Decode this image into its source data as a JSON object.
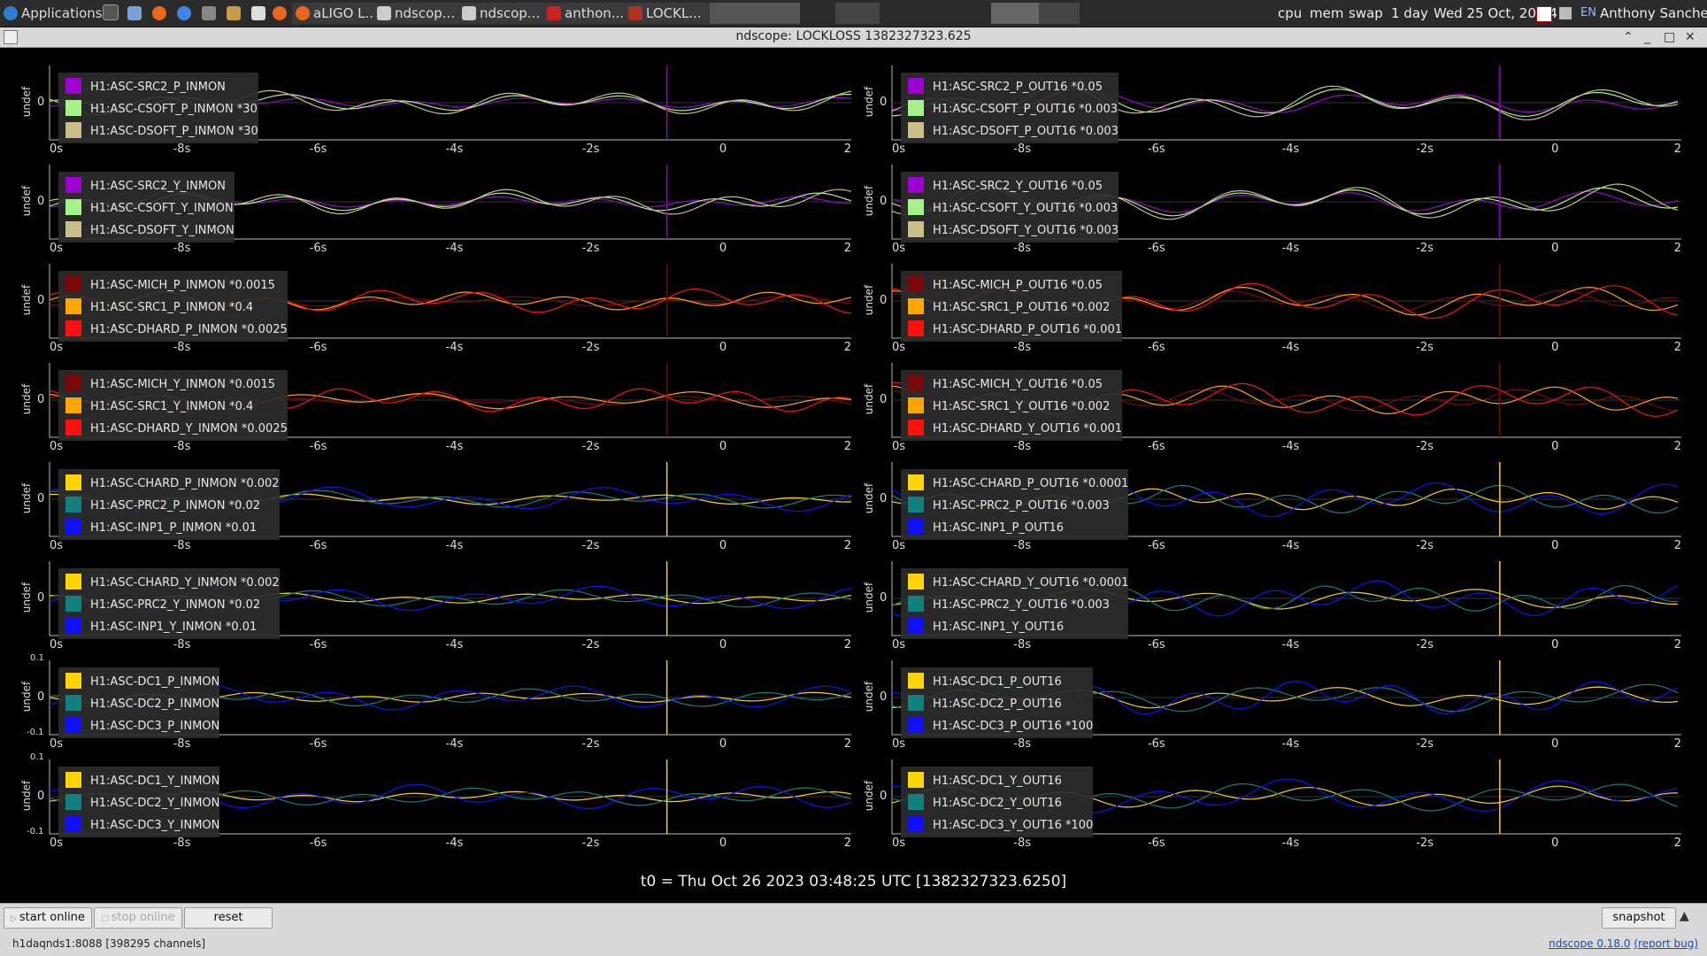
{
  "taskbar": {
    "apps_label": "Applications",
    "windows": [
      {
        "label": "aLIGO L...",
        "icon": "firefox-icon"
      },
      {
        "label": "ndscop...",
        "icon": "window-icon"
      },
      {
        "label": "ndscop...",
        "icon": "window-icon"
      },
      {
        "label": "anthon...",
        "icon": "terminal-icon"
      },
      {
        "label": "LOCKL...",
        "icon": "x-icon"
      }
    ],
    "cpu": "cpu",
    "mem": "mem",
    "swap": "swap",
    "uptime": "1 day",
    "clock": "Wed 25 Oct, 20:54",
    "lang": "EN",
    "user": "Anthony Sanchez"
  },
  "window": {
    "title": "ndscope: LOCKLOSS 1382327323.625"
  },
  "xaxis_ticks": [
    "0s",
    "-8s",
    "-6s",
    "-4s",
    "-2s",
    "0",
    "2"
  ],
  "colors": {
    "purple": "#9b00d0",
    "lightgreen": "#a6f28a",
    "khaki": "#c8c088",
    "darkred": "#7a0a0a",
    "orange": "#ffa500",
    "red": "#ff1010",
    "yellow": "#ffd400",
    "teal": "#118080",
    "blue": "#1010ff"
  },
  "panels": [
    {
      "ylabel": "undef",
      "zero": "0",
      "legend": [
        {
          "name": "H1:ASC-SRC2_P_INMON",
          "color": "#9b00d0"
        },
        {
          "name": "H1:ASC-CSOFT_P_INMON *30",
          "color": "#a6f28a"
        },
        {
          "name": "H1:ASC-DSOFT_P_INMON *30",
          "color": "#c8c088"
        }
      ]
    },
    {
      "ylabel": "undef",
      "zero": "0",
      "legend": [
        {
          "name": "H1:ASC-SRC2_P_OUT16 *0.05",
          "color": "#9b00d0"
        },
        {
          "name": "H1:ASC-CSOFT_P_OUT16 *0.003",
          "color": "#a6f28a"
        },
        {
          "name": "H1:ASC-DSOFT_P_OUT16 *0.003",
          "color": "#c8c088"
        }
      ]
    },
    {
      "ylabel": "undef",
      "zero": "0",
      "legend": [
        {
          "name": "H1:ASC-SRC2_Y_INMON",
          "color": "#9b00d0"
        },
        {
          "name": "H1:ASC-CSOFT_Y_INMON",
          "color": "#a6f28a"
        },
        {
          "name": "H1:ASC-DSOFT_Y_INMON",
          "color": "#c8c088"
        }
      ]
    },
    {
      "ylabel": "undef",
      "zero": "0",
      "legend": [
        {
          "name": "H1:ASC-SRC2_Y_OUT16 *0.05",
          "color": "#9b00d0"
        },
        {
          "name": "H1:ASC-CSOFT_Y_OUT16 *0.003",
          "color": "#a6f28a"
        },
        {
          "name": "H1:ASC-DSOFT_Y_OUT16 *0.003",
          "color": "#c8c088"
        }
      ]
    },
    {
      "ylabel": "undef",
      "zero": "0",
      "legend": [
        {
          "name": "H1:ASC-MICH_P_INMON *0.0015",
          "color": "#7a0a0a"
        },
        {
          "name": "H1:ASC-SRC1_P_INMON *0.4",
          "color": "#ffa500"
        },
        {
          "name": "H1:ASC-DHARD_P_INMON *0.0025",
          "color": "#ff1010"
        }
      ]
    },
    {
      "ylabel": "undef",
      "zero": "0",
      "legend": [
        {
          "name": "H1:ASC-MICH_P_OUT16 *0.05",
          "color": "#7a0a0a"
        },
        {
          "name": "H1:ASC-SRC1_P_OUT16 *0.002",
          "color": "#ffa500"
        },
        {
          "name": "H1:ASC-DHARD_P_OUT16 *0.001",
          "color": "#ff1010"
        }
      ]
    },
    {
      "ylabel": "undef",
      "zero": "0",
      "legend": [
        {
          "name": "H1:ASC-MICH_Y_INMON *0.0015",
          "color": "#7a0a0a"
        },
        {
          "name": "H1:ASC-SRC1_Y_INMON *0.4",
          "color": "#ffa500"
        },
        {
          "name": "H1:ASC-DHARD_Y_INMON *0.0025",
          "color": "#ff1010"
        }
      ]
    },
    {
      "ylabel": "undef",
      "zero": "0",
      "legend": [
        {
          "name": "H1:ASC-MICH_Y_OUT16 *0.05",
          "color": "#7a0a0a"
        },
        {
          "name": "H1:ASC-SRC1_Y_OUT16 *0.002",
          "color": "#ffa500"
        },
        {
          "name": "H1:ASC-DHARD_Y_OUT16 *0.001",
          "color": "#ff1010"
        }
      ]
    },
    {
      "ylabel": "undef",
      "zero": "0",
      "legend": [
        {
          "name": "H1:ASC-CHARD_P_INMON *0.002",
          "color": "#ffd400"
        },
        {
          "name": "H1:ASC-PRC2_P_INMON *0.02",
          "color": "#118080"
        },
        {
          "name": "H1:ASC-INP1_P_INMON *0.01",
          "color": "#1010ff"
        }
      ]
    },
    {
      "ylabel": "undef",
      "zero": "0",
      "legend": [
        {
          "name": "H1:ASC-CHARD_P_OUT16 *0.0001",
          "color": "#ffd400"
        },
        {
          "name": "H1:ASC-PRC2_P_OUT16 *0.003",
          "color": "#118080"
        },
        {
          "name": "H1:ASC-INP1_P_OUT16",
          "color": "#1010ff"
        }
      ]
    },
    {
      "ylabel": "undef",
      "zero": "0",
      "legend": [
        {
          "name": "H1:ASC-CHARD_Y_INMON *0.002",
          "color": "#ffd400"
        },
        {
          "name": "H1:ASC-PRC2_Y_INMON *0.02",
          "color": "#118080"
        },
        {
          "name": "H1:ASC-INP1_Y_INMON *0.01",
          "color": "#1010ff"
        }
      ]
    },
    {
      "ylabel": "undef",
      "zero": "0",
      "legend": [
        {
          "name": "H1:ASC-CHARD_Y_OUT16 *0.0001",
          "color": "#ffd400"
        },
        {
          "name": "H1:ASC-PRC2_Y_OUT16 *0.003",
          "color": "#118080"
        },
        {
          "name": "H1:ASC-INP1_Y_OUT16",
          "color": "#1010ff"
        }
      ]
    },
    {
      "ylabel": "undef",
      "zero": "0",
      "top_tick": "0.1",
      "bottom_tick": "-0.1",
      "legend": [
        {
          "name": "H1:ASC-DC1_P_INMON",
          "color": "#ffd400"
        },
        {
          "name": "H1:ASC-DC2_P_INMON",
          "color": "#118080"
        },
        {
          "name": "H1:ASC-DC3_P_INMON",
          "color": "#1010ff"
        }
      ]
    },
    {
      "ylabel": "undef",
      "zero": "0",
      "legend": [
        {
          "name": "H1:ASC-DC1_P_OUT16",
          "color": "#ffd400"
        },
        {
          "name": "H1:ASC-DC2_P_OUT16",
          "color": "#118080"
        },
        {
          "name": "H1:ASC-DC3_P_OUT16 *100",
          "color": "#1010ff"
        }
      ]
    },
    {
      "ylabel": "undef",
      "zero": "0",
      "top_tick": "0.1",
      "bottom_tick": "-0.1",
      "legend": [
        {
          "name": "H1:ASC-DC1_Y_INMON",
          "color": "#ffd400"
        },
        {
          "name": "H1:ASC-DC2_Y_INMON",
          "color": "#118080"
        },
        {
          "name": "H1:ASC-DC3_Y_INMON",
          "color": "#1010ff"
        }
      ]
    },
    {
      "ylabel": "undef",
      "zero": "0",
      "legend": [
        {
          "name": "H1:ASC-DC1_Y_OUT16",
          "color": "#ffd400"
        },
        {
          "name": "H1:ASC-DC2_Y_OUT16",
          "color": "#118080"
        },
        {
          "name": "H1:ASC-DC3_Y_OUT16 *100",
          "color": "#1010ff"
        }
      ]
    }
  ],
  "t0_label": "t0 = Thu Oct 26 2023 03:48:25 UTC [1382327323.6250]",
  "controls": {
    "start_online": "start online",
    "stop_online": "stop online",
    "reset": "reset",
    "snapshot": "snapshot"
  },
  "status": {
    "server": "h1daqnds1:8088  [398295 channels]",
    "version": "ndscope 0.18.0",
    "report_bug": "(report bug)"
  }
}
